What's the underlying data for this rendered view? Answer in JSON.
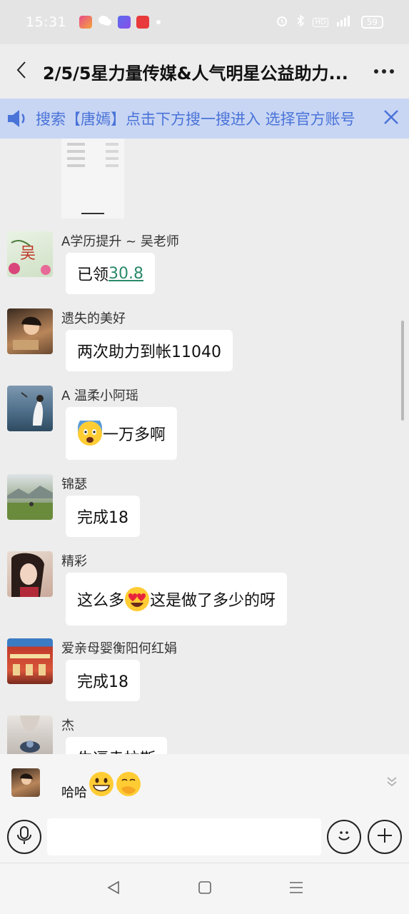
{
  "status_bar": {
    "time": "15:31",
    "battery": "59",
    "hd_label": "HD",
    "app_icons": [
      "app-icon-1",
      "wechat-icon",
      "app-icon-3",
      "toutiao-icon"
    ]
  },
  "header": {
    "title": "2/5/5星力量传媒&人气明星公益助力...",
    "back_icon": "chevron-left-icon",
    "more_icon": "more-dots-icon"
  },
  "notice": {
    "text": "搜索【唐嫣】点击下方搜一搜进入 选择官方账号"
  },
  "messages": [
    {
      "nickname": "A学历提升 ~ 吴老师",
      "prefix": "已领",
      "link": "30.8"
    },
    {
      "nickname": "遗失的美好",
      "text": "两次助力到帐11040"
    },
    {
      "nickname": "A 温柔小阿瑶",
      "emoji": "scared-face-emoji",
      "text": "一万多啊"
    },
    {
      "nickname": "锦瑟",
      "text": "完成18"
    },
    {
      "nickname": "精彩",
      "text_before": "这么多",
      "emoji": "heart-eyes-emoji",
      "text_after": "这是做了多少的呀"
    },
    {
      "nickname": "爱亲母婴衡阳何红娟",
      "text": "完成18"
    },
    {
      "nickname": "杰",
      "text": "牛逼幸拉斯"
    }
  ],
  "composer_preview": {
    "text": "哈哈",
    "emojis": [
      "grinning-emoji",
      "hand-over-mouth-emoji"
    ]
  },
  "input_bar": {
    "voice_icon": "microphone-icon",
    "emoji_icon": "smiley-icon",
    "plus_icon": "plus-icon"
  },
  "colors": {
    "notice_bg": "#c8d6f4",
    "notice_text": "#4a73d8",
    "link": "#2a8a6a",
    "chat_bg": "#ededed"
  }
}
